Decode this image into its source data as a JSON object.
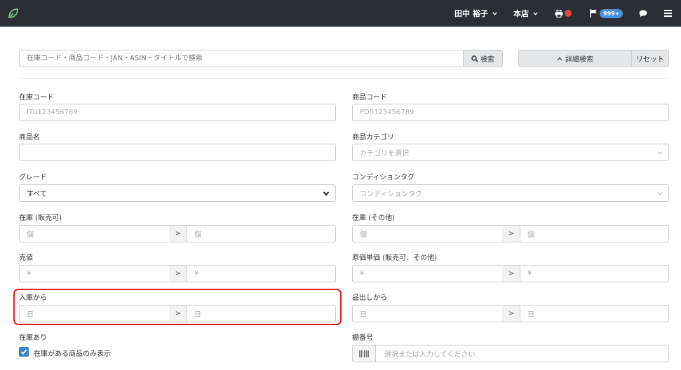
{
  "header": {
    "user_name": "田中 裕子",
    "store_name": "本店",
    "notification_count": "999+"
  },
  "search": {
    "placeholder": "在庫コード・商品コード・JAN・ASIN・タイトルで検索",
    "search_label": "検索",
    "advanced_label": "詳細検索",
    "reset_label": "リセット"
  },
  "form": {
    "stock_code": {
      "label": "在庫コード",
      "placeholder": "IT0123456789"
    },
    "product_code": {
      "label": "商品コード",
      "placeholder": "PD0123456789"
    },
    "product_name": {
      "label": "商品名",
      "value": ""
    },
    "product_category": {
      "label": "商品カテゴリ",
      "placeholder": "カテゴリを選択"
    },
    "grade": {
      "label": "グレード",
      "value": "すべて"
    },
    "condition_tag": {
      "label": "コンディションタグ",
      "placeholder": "コンディションタグ"
    },
    "stock_sellable": {
      "label": "在庫 (販売可)",
      "from_placeholder": "個",
      "to_placeholder": "個"
    },
    "stock_other": {
      "label": "在庫 (その他)",
      "from_placeholder": "個",
      "to_placeholder": "個"
    },
    "price": {
      "label": "売値",
      "from_placeholder": "¥",
      "to_placeholder": "¥"
    },
    "unit_cost": {
      "label": "原価単価 (販売可、その他)",
      "from_placeholder": "¥",
      "to_placeholder": "¥"
    },
    "received_since": {
      "label": "入庫から",
      "from_placeholder": "日",
      "to_placeholder": "日"
    },
    "shipped_since": {
      "label": "品出しから",
      "from_placeholder": "日",
      "to_placeholder": "日"
    },
    "in_stock": {
      "label": "在庫あり",
      "checkbox_label": "在庫がある商品のみ表示"
    },
    "shelf_number": {
      "label": "棚番号",
      "placeholder": "選択または入力してください"
    },
    "range_separator": ">"
  },
  "colors": {
    "topbar": "#2b2f33",
    "accent": "#3a86c8",
    "badge": "#4a90d9",
    "alert": "#e54848",
    "highlight": "#e02020"
  }
}
